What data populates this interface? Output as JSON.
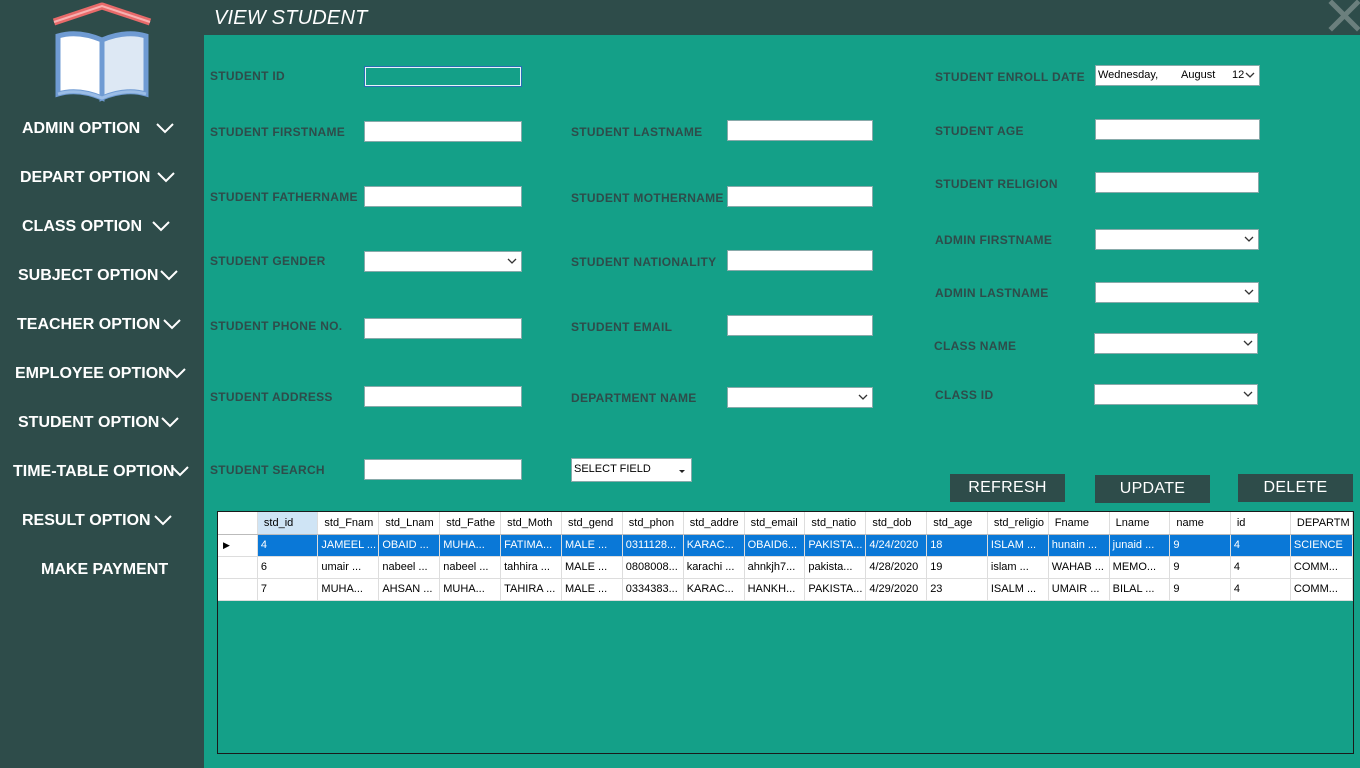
{
  "window": {
    "title": "VIEW STUDENT"
  },
  "sidebar": {
    "items": [
      {
        "label": "ADMIN OPTION"
      },
      {
        "label": "DEPART OPTION"
      },
      {
        "label": "CLASS OPTION"
      },
      {
        "label": "SUBJECT OPTION"
      },
      {
        "label": "TEACHER OPTION"
      },
      {
        "label": "EMPLOYEE OPTION"
      },
      {
        "label": "STUDENT OPTION"
      },
      {
        "label": "TIME-TABLE OPTION"
      },
      {
        "label": "RESULT OPTION"
      },
      {
        "label": "MAKE PAYMENT"
      }
    ]
  },
  "form": {
    "student_id": {
      "label": "STUDENT ID",
      "value": ""
    },
    "firstname": {
      "label": "STUDENT FIRSTNAME",
      "value": ""
    },
    "lastname": {
      "label": "STUDENT LASTNAME",
      "value": ""
    },
    "fathername": {
      "label": "STUDENT FATHERNAME",
      "value": ""
    },
    "mothername": {
      "label": "STUDENT MOTHERNAME",
      "value": ""
    },
    "gender": {
      "label": "STUDENT GENDER",
      "value": ""
    },
    "nationality": {
      "label": "STUDENT NATIONALITY",
      "value": ""
    },
    "phone": {
      "label": "STUDENT PHONE NO.",
      "value": ""
    },
    "email": {
      "label": "STUDENT EMAIL",
      "value": ""
    },
    "address": {
      "label": "STUDENT ADDRESS",
      "value": ""
    },
    "department": {
      "label": "DEPARTMENT NAME",
      "value": ""
    },
    "enroll_date": {
      "label": "STUDENT ENROLL DATE",
      "day": "Wednesday,",
      "month": "August",
      "date": "12"
    },
    "age": {
      "label": "STUDENT AGE",
      "value": ""
    },
    "religion": {
      "label": "STUDENT RELIGION",
      "value": ""
    },
    "admin_firstname": {
      "label": "ADMIN FIRSTNAME",
      "value": ""
    },
    "admin_lastname": {
      "label": "ADMIN LASTNAME",
      "value": ""
    },
    "class_name": {
      "label": "CLASS NAME",
      "value": ""
    },
    "class_id": {
      "label": "CLASS ID",
      "value": ""
    },
    "search": {
      "label": "STUDENT SEARCH",
      "value": ""
    },
    "search_field": {
      "value": "SELECT FIELD"
    }
  },
  "buttons": {
    "refresh": "REFRESH",
    "update": "UPDATE",
    "delete": "DELETE"
  },
  "grid": {
    "columns": [
      "std_id",
      "std_Fnam",
      "std_Lnam",
      "std_Fathe",
      "std_Moth",
      "std_gend",
      "std_phon",
      "std_addre",
      "std_email",
      "std_natio",
      "std_dob",
      "std_age",
      "std_religio",
      "Fname",
      "Lname",
      "name",
      "id",
      "DEPARTM"
    ],
    "row_marker": "▶",
    "rows": [
      [
        "4",
        "JAMEEL ...",
        "OBAID  ...",
        "MUHA...",
        "FATIMA...",
        "MALE    ...",
        "0311128...",
        "KARAC...",
        "OBAID6...",
        "PAKISTA...",
        "4/24/2020",
        "18",
        "ISLAM    ...",
        "hunain ...",
        "junaid  ...",
        "9",
        "4",
        "SCIENCE"
      ],
      [
        "6",
        "umair   ...",
        "nabeel ...",
        "nabeel ...",
        "tahhira ...",
        "MALE    ...",
        "0808008...",
        "karachi ...",
        "ahnkjh7...",
        "pakista...",
        "4/28/2020",
        "19",
        "islam    ...",
        "WAHAB ...",
        "MEMO...",
        "9",
        "4",
        "COMM..."
      ],
      [
        "7",
        "MUHA...",
        "AHSAN ...",
        "MUHA...",
        "TAHIRA ...",
        "MALE    ...",
        "0334383...",
        "KARAC...",
        "HANKH...",
        "PAKISTA...",
        "4/29/2020",
        "23",
        "ISALM    ...",
        "UMAIR  ...",
        "BILAL     ...",
        "9",
        "4",
        "COMM..."
      ]
    ]
  }
}
